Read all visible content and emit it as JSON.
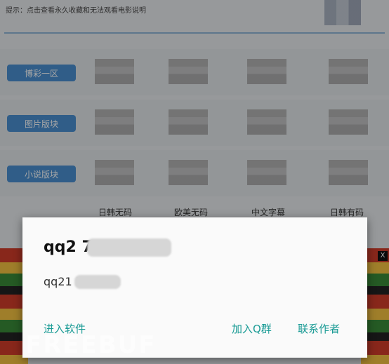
{
  "tip_text": "提示：点击查看永久收藏和无法观看电影说明",
  "categories": [
    "博彩一区",
    "图片版块",
    "小说版块"
  ],
  "thumb_labels": [
    "日韩无码",
    "欧美无码",
    "中文字幕",
    "日韩有码"
  ],
  "dialog": {
    "title": "qq2                    783",
    "message": "qq21               783",
    "btn_enter": "进入软件",
    "btn_join_group": "加入Q群",
    "btn_contact": "联系作者"
  },
  "ad": {
    "close_label": "X"
  },
  "watermark": "FREEBUF"
}
